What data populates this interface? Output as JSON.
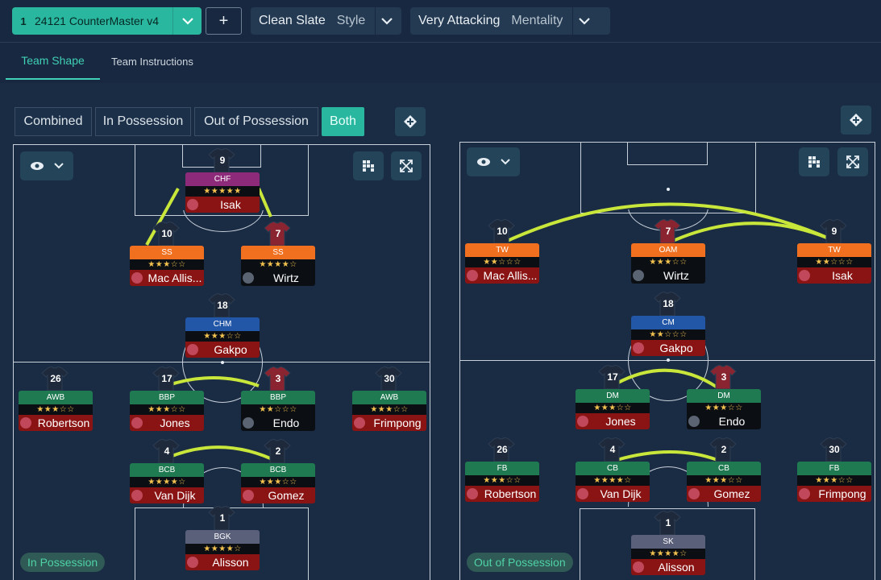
{
  "topbar": {
    "tactic": {
      "slot": "1",
      "name": "24121 CounterMaster v4"
    },
    "add_label": "+",
    "style": {
      "value": "Clean Slate",
      "key": "Style"
    },
    "mentality": {
      "value": "Very Attacking",
      "key": "Mentality"
    }
  },
  "tabs": [
    {
      "label": "Team Shape",
      "active": true
    },
    {
      "label": "Team Instructions",
      "active": false
    }
  ],
  "phase_filter": [
    "Combined",
    "In Possession",
    "Out of Possession",
    "Both"
  ],
  "phase_filter_selected": "Both",
  "colors": {
    "accent": "#2ab7a0",
    "chf": "#8e2a7a",
    "attack": "#f07020",
    "mid": "#2256a6",
    "wingback": "#1f7a52",
    "keeper": "#5a5f7a",
    "name_red": "#8a1414",
    "name_black": "#0b0f14",
    "link": "#c9e63a"
  },
  "left_pitch": {
    "badge": "In Possession",
    "players": [
      {
        "num": "9",
        "role": "CHF",
        "stars": "★★★★★",
        "name": "Isak",
        "own": false
      },
      {
        "num": "10",
        "role": "SS",
        "stars": "★★★☆☆",
        "name": "Mac Allis...",
        "own": false
      },
      {
        "num": "7",
        "role": "SS",
        "stars": "★★★★☆",
        "name": "Wirtz",
        "own": true
      },
      {
        "num": "18",
        "role": "CHM",
        "stars": "★★★☆☆",
        "name": "Gakpo",
        "own": false
      },
      {
        "num": "26",
        "role": "AWB",
        "stars": "★★★☆☆",
        "name": "Robertson",
        "own": false
      },
      {
        "num": "17",
        "role": "BBP",
        "stars": "★★★☆☆",
        "name": "Jones",
        "own": false
      },
      {
        "num": "3",
        "role": "BBP",
        "stars": "★★☆☆☆",
        "name": "Endo",
        "own": true
      },
      {
        "num": "30",
        "role": "AWB",
        "stars": "★★★☆☆",
        "name": "Frimpong",
        "own": false
      },
      {
        "num": "4",
        "role": "BCB",
        "stars": "★★★★☆",
        "name": "Van Dijk",
        "own": false
      },
      {
        "num": "2",
        "role": "BCB",
        "stars": "★★★☆☆",
        "name": "Gomez",
        "own": false
      },
      {
        "num": "1",
        "role": "BGK",
        "stars": "★★★★☆",
        "name": "Alisson",
        "own": false
      }
    ]
  },
  "right_pitch": {
    "badge": "Out of Possession",
    "players": [
      {
        "num": "10",
        "role": "TW",
        "stars": "★★☆☆☆",
        "name": "Mac Allis...",
        "own": false
      },
      {
        "num": "7",
        "role": "OAM",
        "stars": "★★★☆☆",
        "name": "Wirtz",
        "own": true
      },
      {
        "num": "9",
        "role": "TW",
        "stars": "★★☆☆☆",
        "name": "Isak",
        "own": false
      },
      {
        "num": "18",
        "role": "CM",
        "stars": "★★☆☆☆",
        "name": "Gakpo",
        "own": false
      },
      {
        "num": "17",
        "role": "DM",
        "stars": "★★★☆☆",
        "name": "Jones",
        "own": false
      },
      {
        "num": "3",
        "role": "DM",
        "stars": "★★★☆☆",
        "name": "Endo",
        "own": true
      },
      {
        "num": "26",
        "role": "FB",
        "stars": "★★★☆☆",
        "name": "Robertson",
        "own": false
      },
      {
        "num": "4",
        "role": "CB",
        "stars": "★★★★☆",
        "name": "Van Dijk",
        "own": false
      },
      {
        "num": "2",
        "role": "CB",
        "stars": "★★★☆☆",
        "name": "Gomez",
        "own": false
      },
      {
        "num": "30",
        "role": "FB",
        "stars": "★★★☆☆",
        "name": "Frimpong",
        "own": false
      },
      {
        "num": "1",
        "role": "SK",
        "stars": "★★★★☆",
        "name": "Alisson",
        "own": false
      }
    ]
  }
}
